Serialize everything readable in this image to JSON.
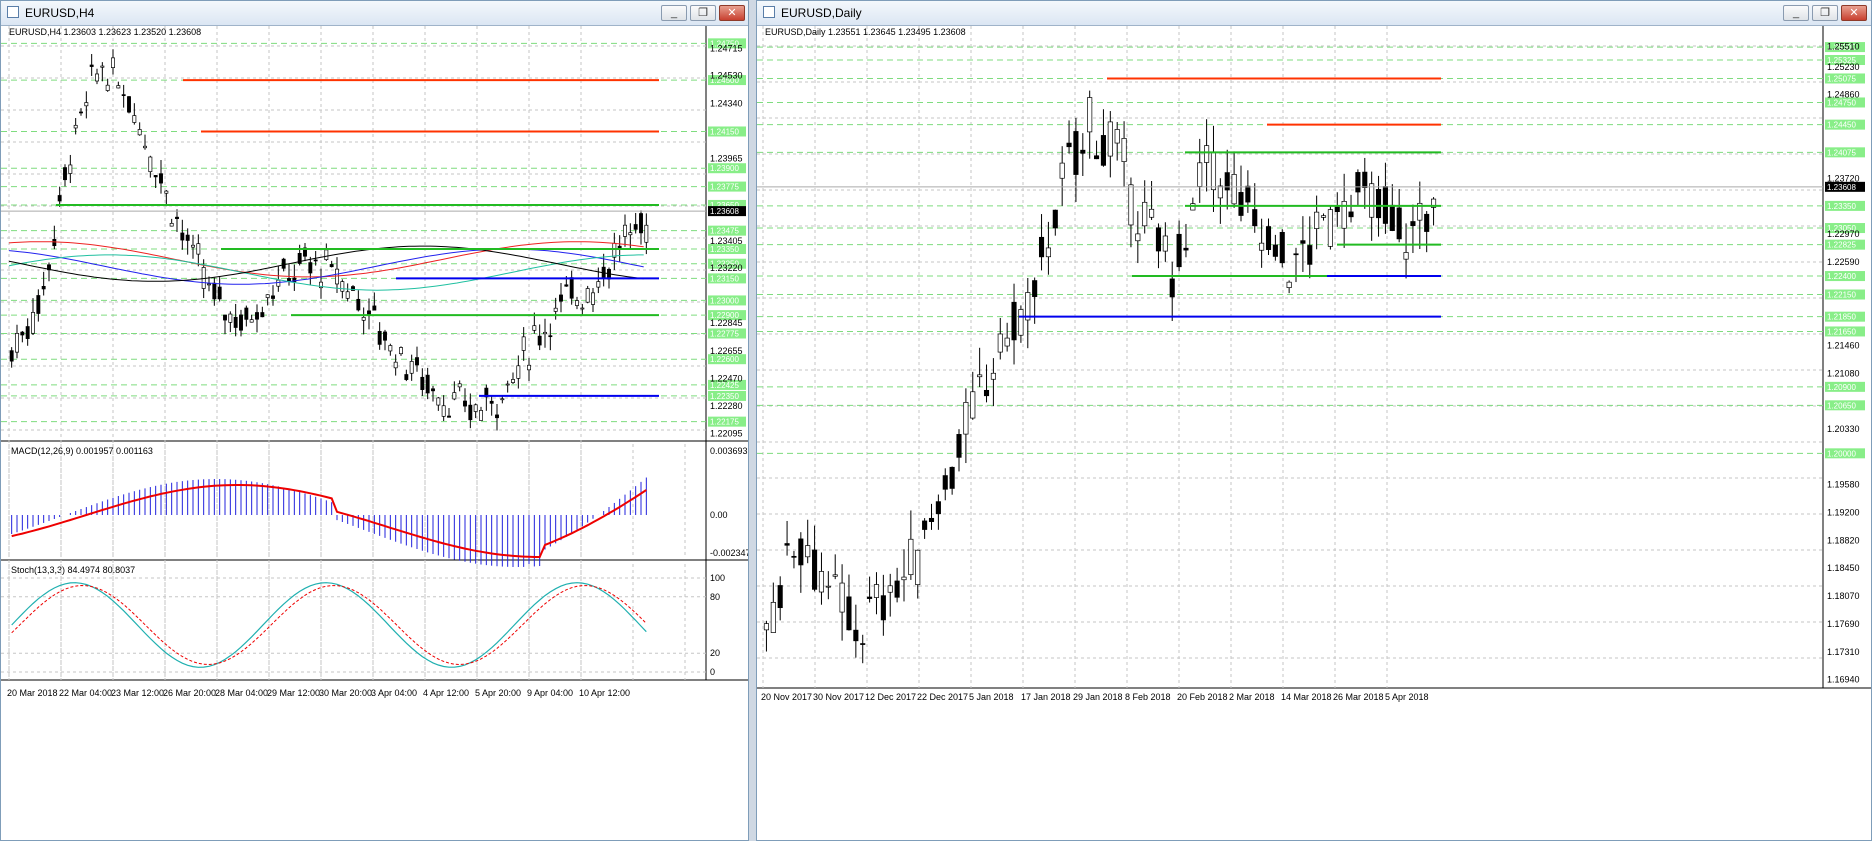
{
  "colors": {
    "resistance": "#ff3300",
    "support": "#22bb22",
    "pivot": "#0000ee",
    "bull": "#ffffff",
    "bear": "#000000",
    "grid": "#c6c6c6",
    "badge": "#88ee88",
    "macd_hist": "#2020dd",
    "macd_signal": "#ee0000",
    "stoch_main": "#20b0b0",
    "stoch_signal": "#ee0000"
  },
  "icons": {
    "window": "chart-window-icon",
    "minimize": "minimize-icon",
    "restore": "restore-icon",
    "close": "close-icon"
  },
  "left": {
    "window_title": "EURUSD,H4",
    "header": "EURUSD,H4  1.23603 1.23623 1.23520 1.23608",
    "price_labels": [
      "1.24715",
      "1.24530",
      "1.24340",
      "1.23965",
      "1.23405",
      "1.23220",
      "1.22845",
      "1.22655",
      "1.22470",
      "1.22280",
      "1.22095"
    ],
    "levels": [
      "1.24750",
      "1.24500",
      "1.24150",
      "1.23900",
      "1.23775",
      "1.23650",
      "1.23475",
      "1.23350",
      "1.23250",
      "1.23150",
      "1.23000",
      "1.22900",
      "1.22775",
      "1.22600",
      "1.22425",
      "1.22350",
      "1.22175"
    ],
    "current_price": "1.23608",
    "x_labels": [
      "20 Mar 2018",
      "22 Mar 04:00",
      "23 Mar 12:00",
      "26 Mar 20:00",
      "28 Mar 04:00",
      "29 Mar 12:00",
      "30 Mar 20:00",
      "3 Apr 04:00",
      "4 Apr 12:00",
      "5 Apr 20:00",
      "9 Apr 04:00",
      "10 Apr 12:00"
    ],
    "macd": {
      "label": "MACD(12,26,9) 0.001957 0.001163",
      "top": "0.003693",
      "zero": "0.00",
      "bottom": "-0.002347"
    },
    "stoch": {
      "label": "Stoch(13,3,3) 84.4974 80.8037",
      "levels": [
        "100",
        "80",
        "20",
        "0"
      ]
    },
    "windows_controls": [
      "_",
      "❐",
      "✕"
    ]
  },
  "right": {
    "window_title": "EURUSD,Daily",
    "header": "EURUSD,Daily  1.23551 1.23645 1.23495 1.23608",
    "price_labels": [
      "1.25510",
      "1.25230",
      "1.24860",
      "1.23720",
      "1.22970",
      "1.22590",
      "1.21460",
      "1.21080",
      "1.20330",
      "1.19580",
      "1.19200",
      "1.18820",
      "1.18450",
      "1.18070",
      "1.17690",
      "1.17310",
      "1.16940"
    ],
    "levels": [
      "1.25500",
      "1.25325",
      "1.25075",
      "1.24750",
      "1.24450",
      "1.24075",
      "1.23350",
      "1.23050",
      "1.22825",
      "1.22400",
      "1.22150",
      "1.21850",
      "1.21650",
      "1.20900",
      "1.20650",
      "1.20000"
    ],
    "current_price": "1.23608",
    "x_labels": [
      "20 Nov 2017",
      "30 Nov 2017",
      "12 Dec 2017",
      "22 Dec 2017",
      "5 Jan 2018",
      "17 Jan 2018",
      "29 Jan 2018",
      "8 Feb 2018",
      "20 Feb 2018",
      "2 Mar 2018",
      "14 Mar 2018",
      "26 Mar 2018",
      "5 Apr 2018"
    ],
    "windows_controls": [
      "_",
      "❐",
      "✕"
    ]
  }
}
